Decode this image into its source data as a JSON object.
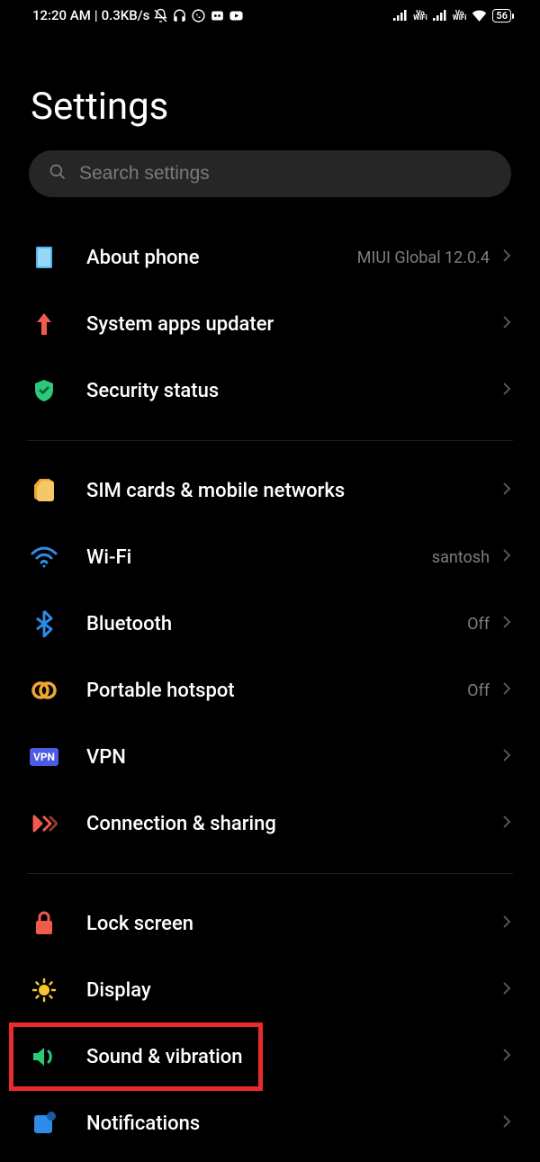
{
  "statusBar": {
    "time": "12:20 AM",
    "netSpeed": "0.3KB/s",
    "battery": "56"
  },
  "page": {
    "title": "Settings"
  },
  "search": {
    "placeholder": "Search settings"
  },
  "groups": [
    {
      "items": [
        {
          "label": "About phone",
          "value": "MIUI Global 12.0.4",
          "icon": "about-phone-icon"
        },
        {
          "label": "System apps updater",
          "value": "",
          "icon": "updater-icon"
        },
        {
          "label": "Security status",
          "value": "",
          "icon": "security-icon"
        }
      ]
    },
    {
      "items": [
        {
          "label": "SIM cards & mobile networks",
          "value": "",
          "icon": "sim-icon"
        },
        {
          "label": "Wi-Fi",
          "value": "santosh",
          "icon": "wifi-icon"
        },
        {
          "label": "Bluetooth",
          "value": "Off",
          "icon": "bluetooth-icon"
        },
        {
          "label": "Portable hotspot",
          "value": "Off",
          "icon": "hotspot-icon"
        },
        {
          "label": "VPN",
          "value": "",
          "icon": "vpn-icon"
        },
        {
          "label": "Connection & sharing",
          "value": "",
          "icon": "connection-icon"
        }
      ]
    },
    {
      "items": [
        {
          "label": "Lock screen",
          "value": "",
          "icon": "lock-icon"
        },
        {
          "label": "Display",
          "value": "",
          "icon": "display-icon"
        },
        {
          "label": "Sound & vibration",
          "value": "",
          "icon": "sound-icon",
          "highlighted": true
        },
        {
          "label": "Notifications",
          "value": "",
          "icon": "notifications-icon"
        }
      ]
    }
  ]
}
